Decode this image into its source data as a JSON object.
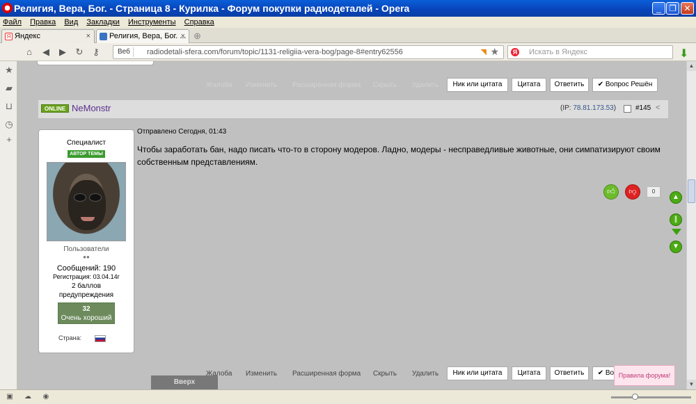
{
  "window": {
    "title": "Религия, Вера, Бог. - Страница 8 - Курилка - Форум покупки радиодеталей - Opera"
  },
  "menu": [
    "Файл",
    "Правка",
    "Вид",
    "Закладки",
    "Инструменты",
    "Справка"
  ],
  "tabs": [
    {
      "label": "Яндекс"
    },
    {
      "label": "Религия, Вера, Бог. ..."
    }
  ],
  "address": {
    "badge": "Веб",
    "url": "radiodetali-sfera.com/forum/topic/1131-religiia-vera-bog/page-8#entry62556"
  },
  "search": {
    "placeholder": "Искать в Яндекс"
  },
  "actions_top": {
    "links": [
      "Жалоба",
      "Изменить",
      "Расширенная форма",
      "Скрыть",
      "Удалить"
    ],
    "buttons": [
      "Ник или цитата",
      "Цитата",
      "Ответить",
      "✔ Вопрос Решён"
    ]
  },
  "post": {
    "online": "ONLINE",
    "author": "NeMonstr",
    "ip_prefix": "(IP: ",
    "ip": "78.81.173.53",
    "ip_suffix": ")",
    "number": "#145",
    "posted": "Отправлено Сегодня, 01:43",
    "body": "Чтобы заработать бан, надо писать что-то в сторону модеров. Ладно, модеры - несправедливые животные, они симпатизируют своим собственным представлениям.",
    "rep_count": "0"
  },
  "user": {
    "title": "Специалист",
    "badge": "АВТОР ТЕМЫ",
    "group": "Пользователи",
    "dots": "●●",
    "posts": "Сообщений: 190",
    "reg": "Регистрация: 03.04.14г",
    "warn1": "2 баллов",
    "warn2": "предупреждения",
    "rep_num": "32",
    "rep_label": "Очень хороший",
    "country": "Страна:"
  },
  "actions_bottom": {
    "links": [
      "Жалоба",
      "Изменить",
      "Расширенная форма",
      "Скрыть",
      "Удалить"
    ],
    "buttons": [
      "Ник или цитата",
      "Цитата",
      "Ответить",
      "✔ Вопрос Решён"
    ]
  },
  "top_button": "Вверх",
  "rules_button": "Правила форума!"
}
